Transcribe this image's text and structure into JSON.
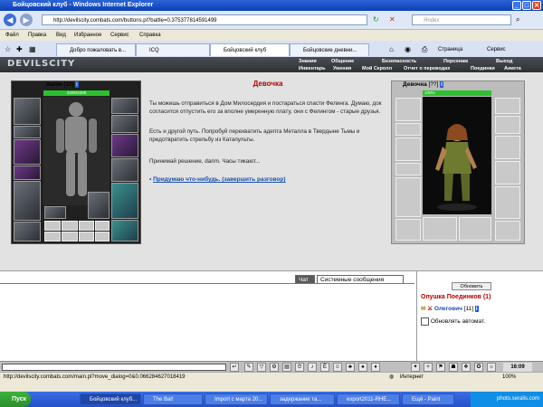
{
  "window": {
    "title": "Бойцовский клуб - Windows Internet Explorer",
    "min": "_",
    "max": "□",
    "close": "✕"
  },
  "address": {
    "url": "http://devilscity.combats.com/buttons.pl?battle=0.375377814591499",
    "search_placeholder": "Яndex"
  },
  "menu": [
    "Файл",
    "Правка",
    "Вид",
    "Избранное",
    "Сервис",
    "Справка"
  ],
  "tabs": [
    {
      "label": "Добро пожаловать в..."
    },
    {
      "label": "ICQ"
    },
    {
      "label": "Бойцовский клуб"
    },
    {
      "label": "Бойцовские дневни..."
    }
  ],
  "toolbar": {
    "page": "Страница",
    "tools": "Сервис"
  },
  "game": {
    "logo": "DEVILSCITY",
    "nav_top": [
      "Знания",
      "Общение",
      "Безопасность",
      "Персонаж",
      "Выход"
    ],
    "nav_bottom": [
      "Инвентарь",
      "Умения",
      "Мой Скролл",
      "Отчет о переводах",
      "Поединки",
      "Анкета"
    ]
  },
  "player": {
    "name": "darim",
    "level": "[10]",
    "hp": "2205/2205"
  },
  "dialog": {
    "title": "Девочка",
    "p1": "Ты можешь отправиться в Дом Милосердия и постараться спасти Фелинга. Думаю, док согласится отпустить его за вполне умеренную плату, они с Фелингом - старые друзья.",
    "p2": "Есть и другой путь. Попробуй перехватить адепта Металла в Твердыне Тьмы и предотвратить стрельбу из Катапульты.",
    "p3": "Принимай решение, darim. Часы тикают...",
    "choice": "Придумаю что-нибудь. (завершить разговор)"
  },
  "npc": {
    "name": "Девочка",
    "level": "[??]",
    "hp": "100%"
  },
  "chat": {
    "tab_chat": "Чат",
    "tab_system": "Системные сообщения",
    "refresh": "Обновить",
    "location": "Опушка Поединков (1)",
    "user": "Олегович",
    "user_level": "[11]",
    "auto_refresh": "Обновлять автомат."
  },
  "clock": "16:09",
  "status": {
    "url": "http://devilscity.combats.com/main.pl?move_dialog=0&0.066284627018419",
    "zone": "Интернет",
    "zoom": "100%"
  },
  "taskbar": {
    "start": "Пуск",
    "items": [
      {
        "label": "Бойцовский клуб..."
      },
      {
        "label": "The Bat!"
      },
      {
        "label": "Import с марта 20..."
      },
      {
        "label": "задержание та..."
      },
      {
        "label": "export2011-RHE..."
      },
      {
        "label": "Ещё - Paint"
      }
    ],
    "watermark": "photo.seralis.com"
  },
  "colors": {
    "accent": "#b30000",
    "link": "#1a4fb0",
    "hp": "#2ec02e"
  }
}
